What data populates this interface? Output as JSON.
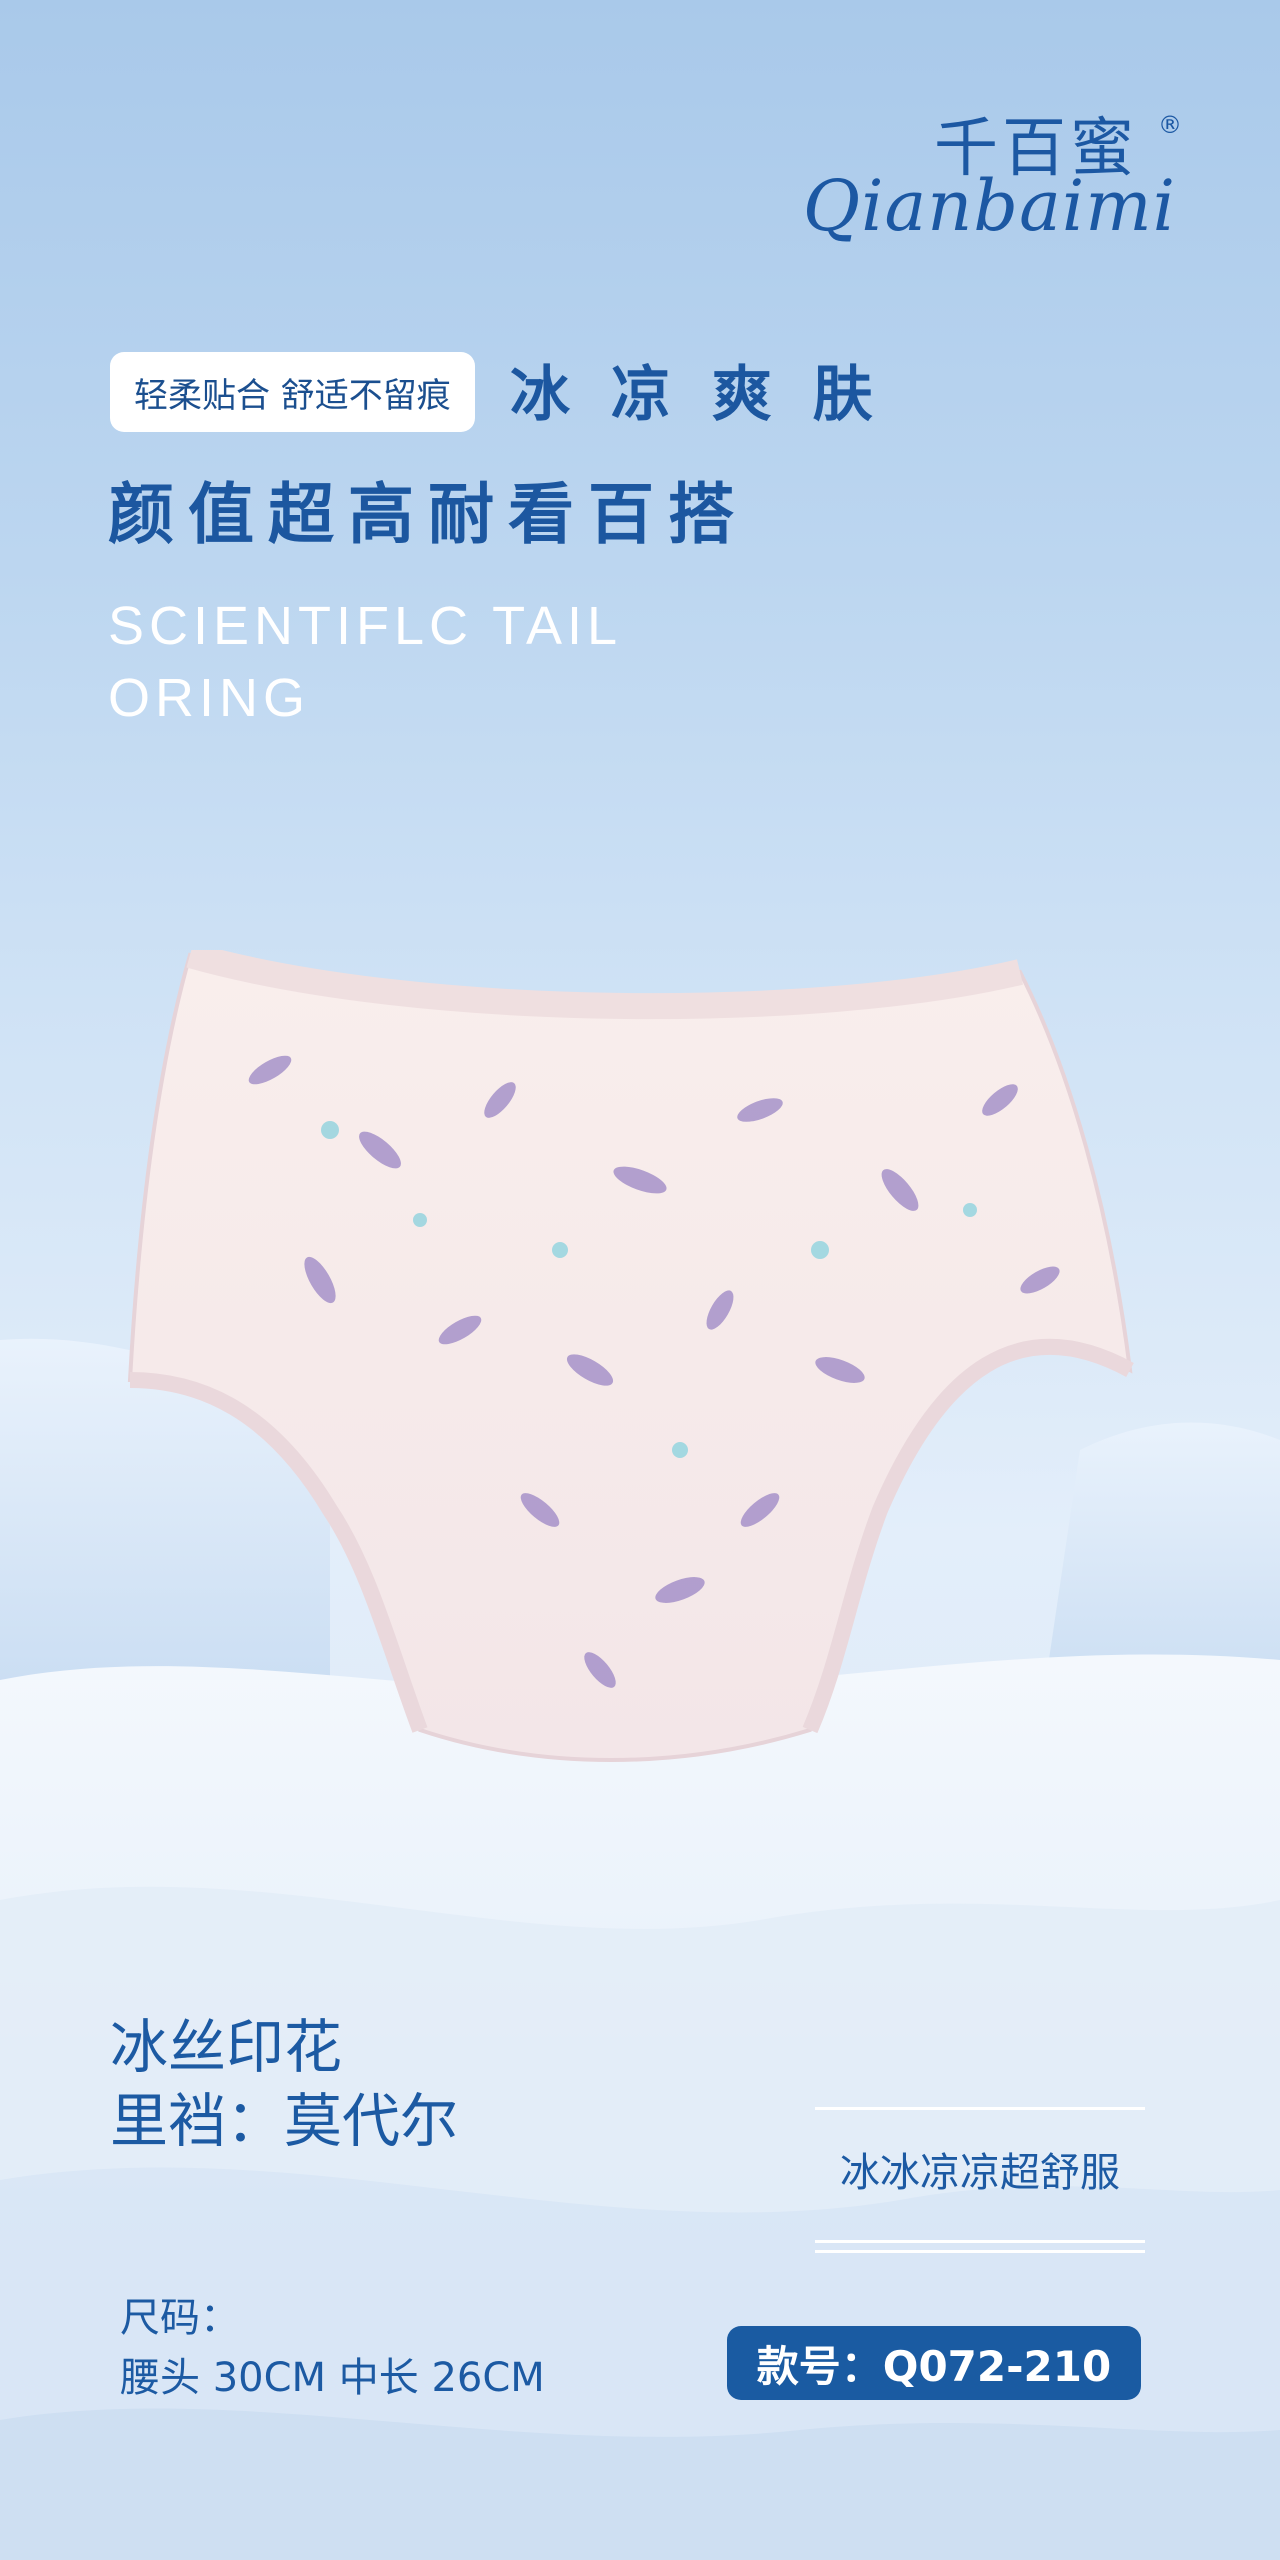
{
  "brand": {
    "name_cn": "千百蜜",
    "name_en": "Qianbaimi",
    "registered": "®"
  },
  "tag_pill": "轻柔贴合 舒适不留痕",
  "tag_highlight": "冰 凉 爽 肤",
  "headline": "颜值超高耐看百搭",
  "english_lines": [
    "SCIENTIFLC TAIL",
    "ORING"
  ],
  "features": [
    "冰丝印花",
    "里裆：莫代尔"
  ],
  "slogan": "冰冰凉凉超舒服",
  "size": {
    "title": "尺码：",
    "value": "腰头 30CM  中长 26CM"
  },
  "model_number": "款号：Q072-210",
  "colors": {
    "brand_blue": "#1c5aa3",
    "model_badge": "#1a5ba2",
    "product_base": "#f7ebe8",
    "print_purple": "#9b86c4"
  },
  "icons": [
    "registered-mark"
  ]
}
